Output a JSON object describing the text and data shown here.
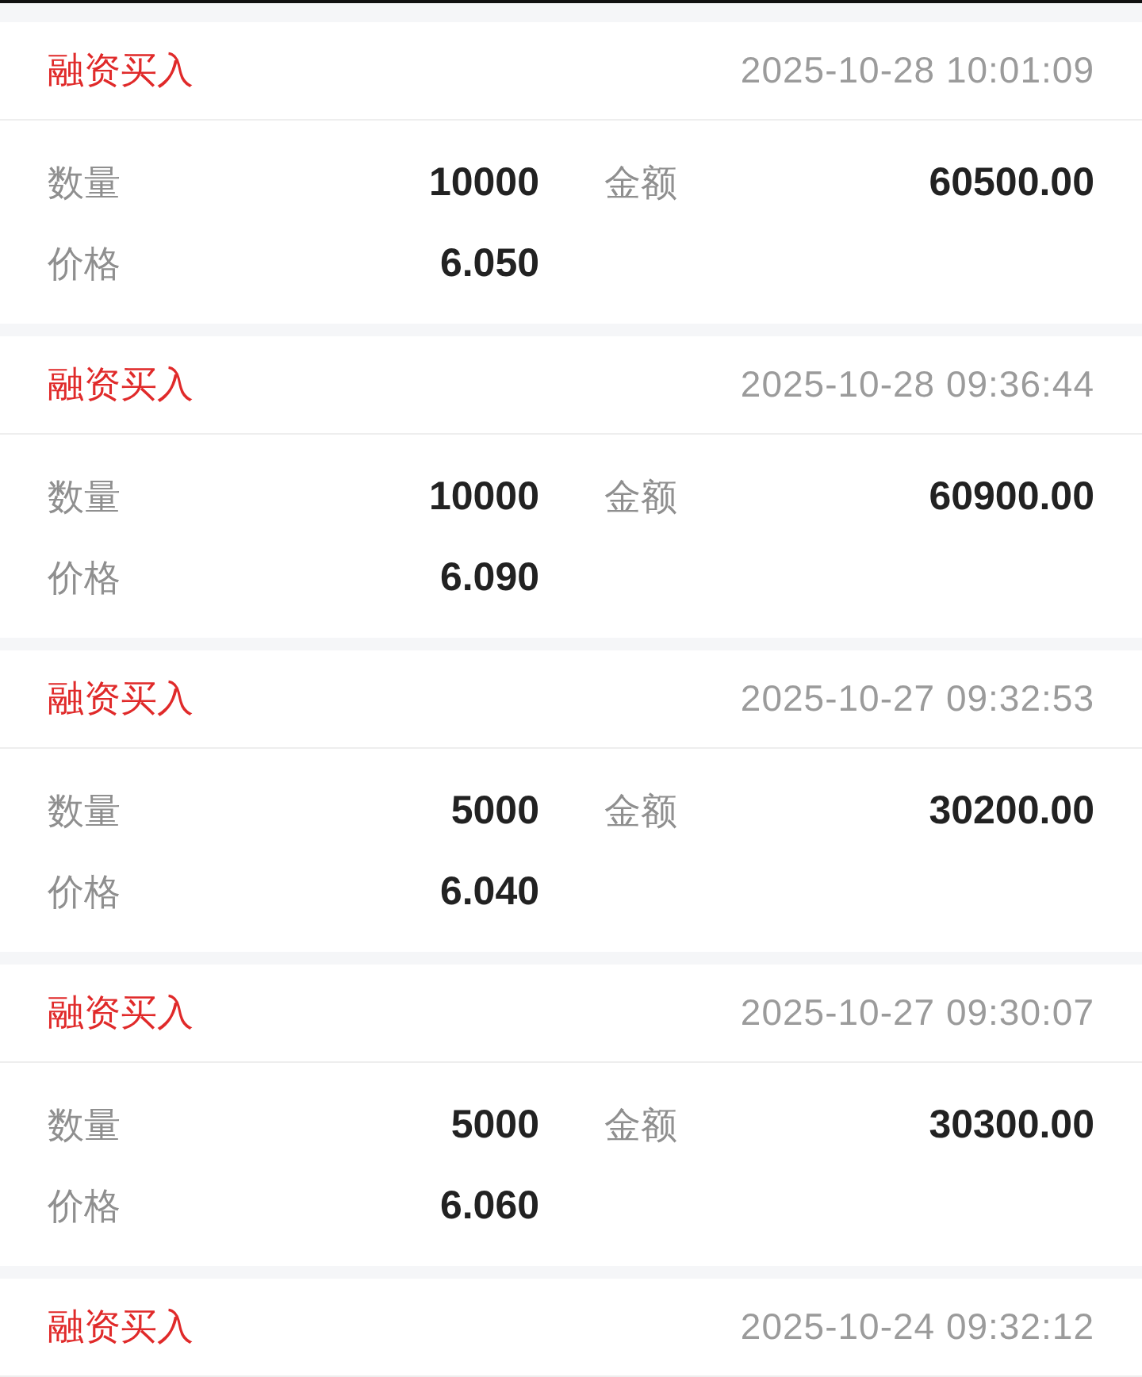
{
  "records": [
    {
      "type": "融资买入",
      "time": "2025-10-28 10:01:09",
      "fields": [
        {
          "label": "数量",
          "value": "10000"
        },
        {
          "label": "金额",
          "value": "60500.00"
        },
        {
          "label": "价格",
          "value": "6.050"
        }
      ]
    },
    {
      "type": "融资买入",
      "time": "2025-10-28 09:36:44",
      "fields": [
        {
          "label": "数量",
          "value": "10000"
        },
        {
          "label": "金额",
          "value": "60900.00"
        },
        {
          "label": "价格",
          "value": "6.090"
        }
      ]
    },
    {
      "type": "融资买入",
      "time": "2025-10-27 09:32:53",
      "fields": [
        {
          "label": "数量",
          "value": "5000"
        },
        {
          "label": "金额",
          "value": "30200.00"
        },
        {
          "label": "价格",
          "value": "6.040"
        }
      ]
    },
    {
      "type": "融资买入",
      "time": "2025-10-27 09:30:07",
      "fields": [
        {
          "label": "数量",
          "value": "5000"
        },
        {
          "label": "金额",
          "value": "30300.00"
        },
        {
          "label": "价格",
          "value": "6.060"
        }
      ]
    },
    {
      "type": "融资买入",
      "time": "2025-10-24 09:32:12"
    }
  ]
}
